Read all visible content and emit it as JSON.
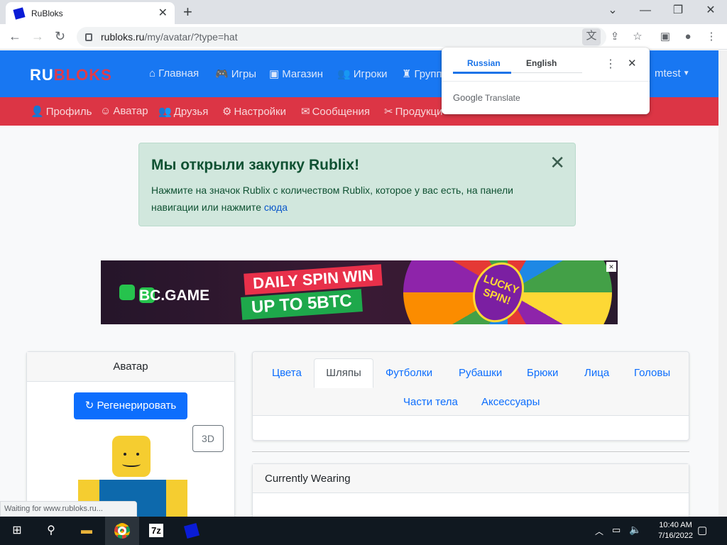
{
  "browser": {
    "tab_title": "RuBloks",
    "url_host": "rubloks.ru",
    "url_path": "/my/avatar/?type=hat",
    "status_text": "Waiting for www.rubloks.ru..."
  },
  "translate_popup": {
    "lang_source": "Russian",
    "lang_target": "English",
    "brand": "Google",
    "brand_suffix": "Translate"
  },
  "site": {
    "logo_a": "RU",
    "logo_b": "BLOKS",
    "top_nav": [
      {
        "icon": "home-icon",
        "glyph": "⌂",
        "label": "Главная"
      },
      {
        "icon": "gamepad-icon",
        "glyph": "🎮",
        "label": "Игры"
      },
      {
        "icon": "store-icon",
        "glyph": "▣",
        "label": "Магазин"
      },
      {
        "icon": "users-icon",
        "glyph": "👥",
        "label": "Игроки"
      },
      {
        "icon": "groups-icon",
        "glyph": "♜",
        "label": "Групп"
      }
    ],
    "user_label": "mtest",
    "sub_nav": [
      {
        "icon": "user-icon",
        "glyph": "👤",
        "label": "Профиль"
      },
      {
        "icon": "avatar-icon",
        "glyph": "☺",
        "label": "Аватар"
      },
      {
        "icon": "friends-icon",
        "glyph": "👥",
        "label": "Друзья"
      },
      {
        "icon": "gear-icon",
        "glyph": "⚙",
        "label": "Настройки"
      },
      {
        "icon": "envelope-icon",
        "glyph": "✉",
        "label": "Сообщения"
      },
      {
        "icon": "tools-icon",
        "glyph": "✂",
        "label": "Продукци"
      }
    ]
  },
  "alert": {
    "title": "Мы открыли закупку Rublix!",
    "body": "Нажмите на значок Rublix с количеством Rublix, которое у вас есть, на панели навигации или нажмите ",
    "link": "сюда",
    "close": "✕"
  },
  "ad": {
    "brand": "BC.GAME",
    "line1": "DAILY SPIN WIN",
    "line2": "UP TO 5BTC",
    "wheel_center": "LUCKY SPIN!"
  },
  "avatar_card": {
    "header": "Аватар",
    "regenerate": "Регенерировать",
    "btn_3d": "3D"
  },
  "item_tabs": [
    "Цвета",
    "Шляпы",
    "Футболки",
    "Рубашки",
    "Брюки",
    "Лица",
    "Головы",
    "Части тела",
    "Аксессуары"
  ],
  "active_tab": "Шляпы",
  "wearing": {
    "header": "Currently Wearing"
  },
  "taskbar": {
    "time": "10:40 AM",
    "date": "7/16/2022"
  }
}
